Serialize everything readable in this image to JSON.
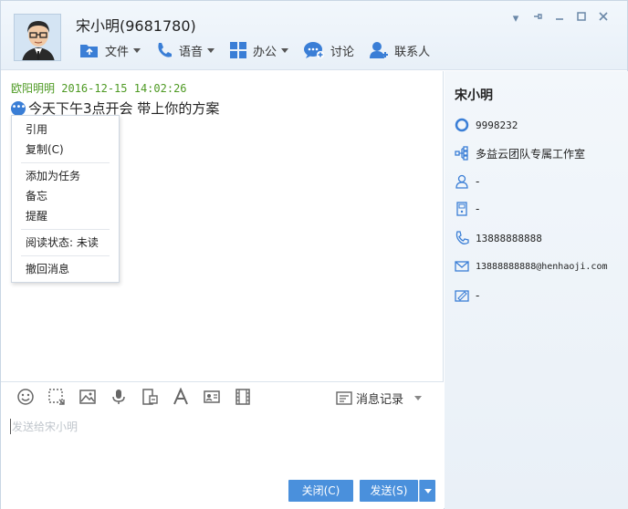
{
  "window": {
    "title": "宋小明(9681780)"
  },
  "toolbar": {
    "file": "文件",
    "voice": "语音",
    "office": "办公",
    "discuss": "讨论",
    "contacts": "联系人"
  },
  "message": {
    "sender": "欧阳明明",
    "time": "2016-12-15 14:02:26",
    "text": "今天下午3点开会 带上你的方案"
  },
  "context_menu": {
    "items": [
      "引用",
      "复制(C)",
      "添加为任务",
      "备忘",
      "提醒",
      "阅读状态: 未读",
      "撤回消息"
    ]
  },
  "input": {
    "placeholder": "发送给宋小明",
    "history_label": "消息记录",
    "close_label": "关闭(C)",
    "send_label": "发送(S)"
  },
  "profile": {
    "name": "宋小明",
    "id": "9998232",
    "org": "多益云团队专属工作室",
    "dept": "-",
    "phone_ext": "-",
    "mobile": "13888888888",
    "email": "13888888888@henhaoji.com",
    "signature": "-"
  },
  "colors": {
    "accent": "#4a90dc",
    "sender_green": "#4e9a23",
    "icon_blue": "#3a7ed6"
  }
}
